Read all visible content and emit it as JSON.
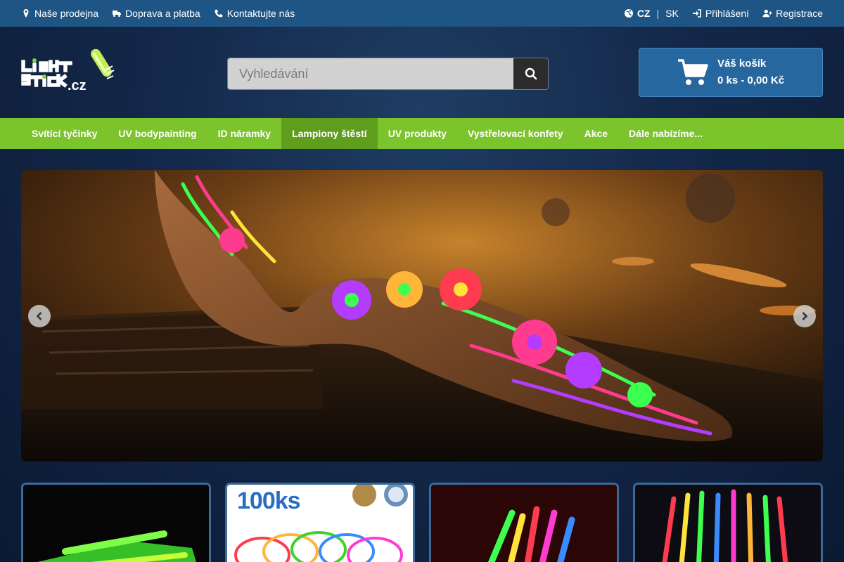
{
  "topbar": {
    "store": "Naše prodejna",
    "shipping": "Doprava a platba",
    "contact": "Kontaktujte nás",
    "lang_active": "CZ",
    "lang_sep": "|",
    "lang_other": "SK",
    "login": "Přihlášení",
    "register": "Registrace"
  },
  "header": {
    "search_placeholder": "Vyhledávání",
    "cart_title": "Váš košík",
    "cart_summary": "0 ks - 0,00 Kč"
  },
  "nav": {
    "items": [
      {
        "label": "Svítící tyčinky"
      },
      {
        "label": "UV bodypainting"
      },
      {
        "label": "ID náramky"
      },
      {
        "label": "Lampiony štěstí"
      },
      {
        "label": "UV produkty"
      },
      {
        "label": "Vystřelovací konfety"
      },
      {
        "label": "Akce"
      },
      {
        "label": "Dále nabízíme..."
      }
    ],
    "active_index": 3
  },
  "tiles": {
    "second_label": "100ks"
  },
  "colors": {
    "topbar": "#1f5585",
    "nav": "#7bc42b",
    "nav_active": "#5f9d1d",
    "cart": "#27679f"
  }
}
